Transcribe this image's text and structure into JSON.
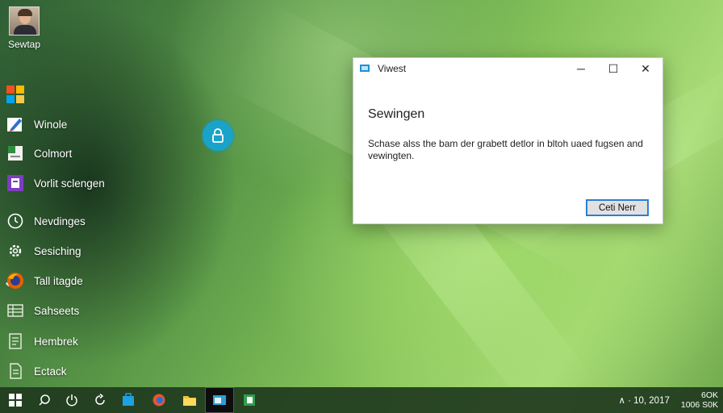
{
  "desktop": {
    "user_label": "Sewtap"
  },
  "menu": {
    "items": [
      {
        "label": "",
        "icon": "office-apps-icon"
      },
      {
        "label": "Winole",
        "icon": "pen-app-icon"
      },
      {
        "label": "Colmort",
        "icon": "document-app-icon"
      },
      {
        "label": "Vorlit sclengen",
        "icon": "purple-app-icon"
      },
      {
        "label": "Nevdinges",
        "icon": "clock-icon"
      },
      {
        "label": "Sesiching",
        "icon": "settings-icon"
      },
      {
        "label": "Tall itagde",
        "icon": "firefox-icon"
      },
      {
        "label": "Sahseets",
        "icon": "sheets-icon"
      },
      {
        "label": "Hembrek",
        "icon": "notebook-icon"
      },
      {
        "label": "Ectack",
        "icon": "doc-icon"
      }
    ]
  },
  "dialog": {
    "title": "Viwest",
    "heading": "Sewingen",
    "body": "Schase alss the bam der grabett detlor in bltoh uaed fugsen and vewingten.",
    "button_label": "Ceti Nerr",
    "minimize": "─",
    "maximize": "☐",
    "close": "✕"
  },
  "taskbar": {
    "tray_text": "∧ · 10, 2017",
    "clock_line1": "6OK",
    "clock_line2": "1006 S0K",
    "colors": {
      "accent": "#2b7fd3",
      "lock": "#1aa3c9"
    }
  }
}
